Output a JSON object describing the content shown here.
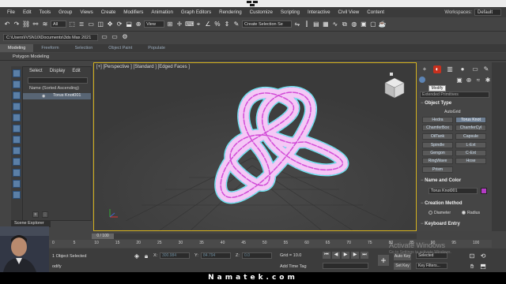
{
  "menu": {
    "items": [
      "File",
      "Edit",
      "Tools",
      "Group",
      "Views",
      "Create",
      "Modifiers",
      "Animation",
      "Graph Editors",
      "Rendering",
      "Customize",
      "Scripting",
      "Interactive",
      "Civil View",
      "Content"
    ],
    "workspaces_label": "Workspaces:",
    "workspace_value": "Default"
  },
  "toolbar": {
    "selection_filter": "All",
    "reference_coord": "View",
    "named_selection_placeholder": "Create Selection Se"
  },
  "project_path": "C:\\Users\\IVSN10\\Documents\\3ds Max 2021",
  "ribbon": {
    "tabs": [
      "Modeling",
      "Freeform",
      "Selection",
      "Object Paint",
      "Populate"
    ],
    "active_tab": "Modeling",
    "subtitle": "Polygon Modeling"
  },
  "scene_explorer": {
    "menus": [
      "Select",
      "Display",
      "Edit"
    ],
    "column_header": "Name (Sorted Ascending)",
    "object": "Torus Knot001",
    "tab_label": "Scene Explorer"
  },
  "viewport": {
    "label": "[+] [Perspective ] [Standard ] [Edged Faces ]",
    "wire_color": "#d24bd6",
    "edge_color": "#6fe6f0"
  },
  "command_panel": {
    "tooltip": "Modify",
    "category": "Extended Primitives",
    "object_type_header": "Object Type",
    "autogrid": "AutoGrid",
    "buttons": [
      "Hedra",
      "Torus Knot",
      "ChamferBox",
      "ChamferCyl",
      "OilTank",
      "Capsule",
      "Spindle",
      "L-Ext",
      "Gengon",
      "C-Ext",
      "RingWave",
      "Hose",
      "Prism"
    ],
    "active_button": "Torus Knot",
    "name_color_header": "Name and Color",
    "object_name": "Torus Knot001",
    "object_color": "#b43bc4",
    "creation_method_header": "Creation Method",
    "creation_options": [
      "Diameter",
      "Radius"
    ],
    "creation_selected": "Radius",
    "keyboard_entry_header": "Keyboard Entry"
  },
  "timeline": {
    "slider_label": "0 / 100",
    "ticks": [
      "0",
      "5",
      "10",
      "15",
      "20",
      "25",
      "30",
      "35",
      "40",
      "45",
      "50",
      "55",
      "60",
      "65",
      "70",
      "75",
      "80",
      "85",
      "90",
      "95",
      "100"
    ]
  },
  "status": {
    "selection": "1 Object Selected",
    "modify_hint": "odify",
    "x_label": "X:",
    "x_value": "300.984",
    "y_label": "Y:",
    "y_value": "84.794",
    "z_label": "Z:",
    "z_value": "0.0",
    "grid": "Grid = 10.0",
    "add_time_tag": "Add Time Tag",
    "auto_key": "Auto Key",
    "set_key": "Set Key",
    "key_filters": "Key Filters...",
    "selected_dropdown": "Selected"
  },
  "watermark": {
    "line1": "Activate Windows",
    "line2": "Go to Settings to activate Windows."
  },
  "footer_brand": "Namatek.com"
}
